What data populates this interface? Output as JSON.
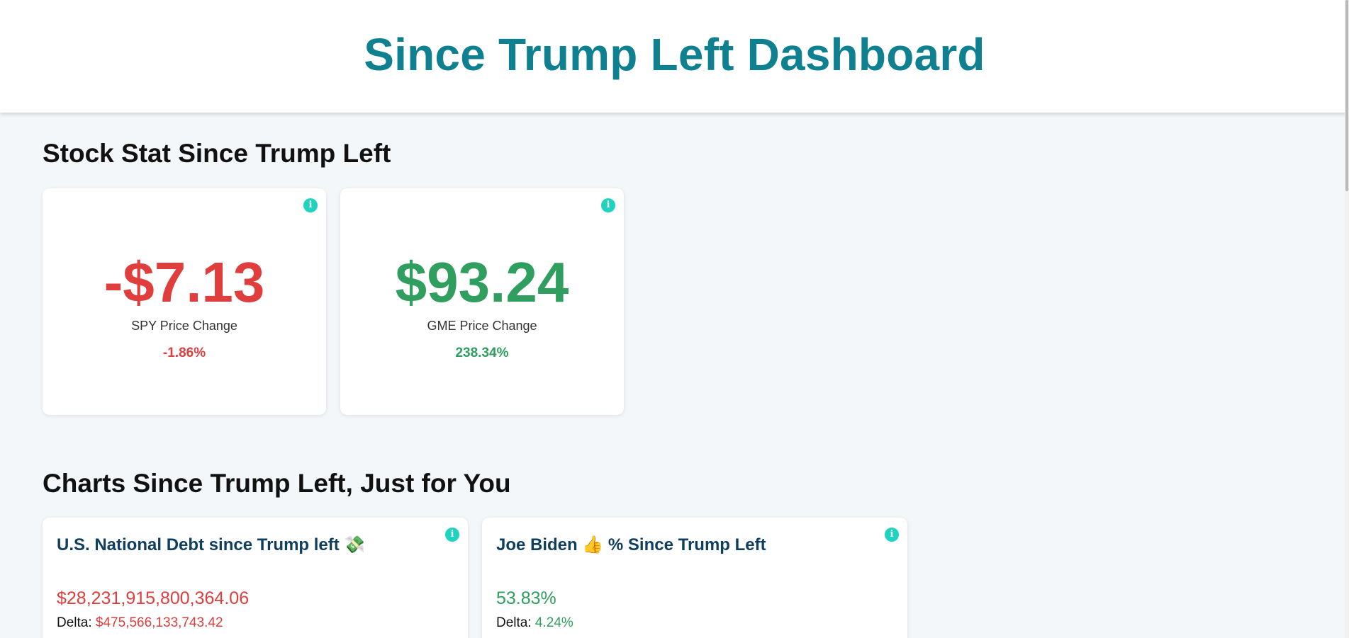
{
  "header": {
    "title": "Since Trump Left Dashboard"
  },
  "sections": {
    "stocks_title": "Stock Stat Since Trump Left",
    "charts_title": "Charts Since Trump Left, Just for You"
  },
  "stocks": [
    {
      "value": "-$7.13",
      "label": "SPY Price Change",
      "percent": "-1.86%",
      "trend": "down"
    },
    {
      "value": "$93.24",
      "label": "GME Price Change",
      "percent": "238.34%",
      "trend": "up"
    }
  ],
  "charts": [
    {
      "title": "U.S. National Debt since Trump left 💸",
      "value": "$28,231,915,800,364.06",
      "delta_label": "Delta:",
      "delta_value": "$475,566,133,743.42",
      "trend": "down"
    },
    {
      "title": "Joe Biden 👍 % Since Trump Left",
      "value": "53.83%",
      "delta_label": "Delta:",
      "delta_value": "4.24%",
      "trend": "up"
    }
  ],
  "icons": {
    "info": "info-icon",
    "info_glyph": "i"
  },
  "colors": {
    "title_teal": "#0e8090",
    "negative_red": "#e03d3d",
    "positive_green": "#2f9e5e",
    "info_teal": "#1ed3c0",
    "chart_title_navy": "#103e5e",
    "page_bg": "#f4f7fa"
  }
}
